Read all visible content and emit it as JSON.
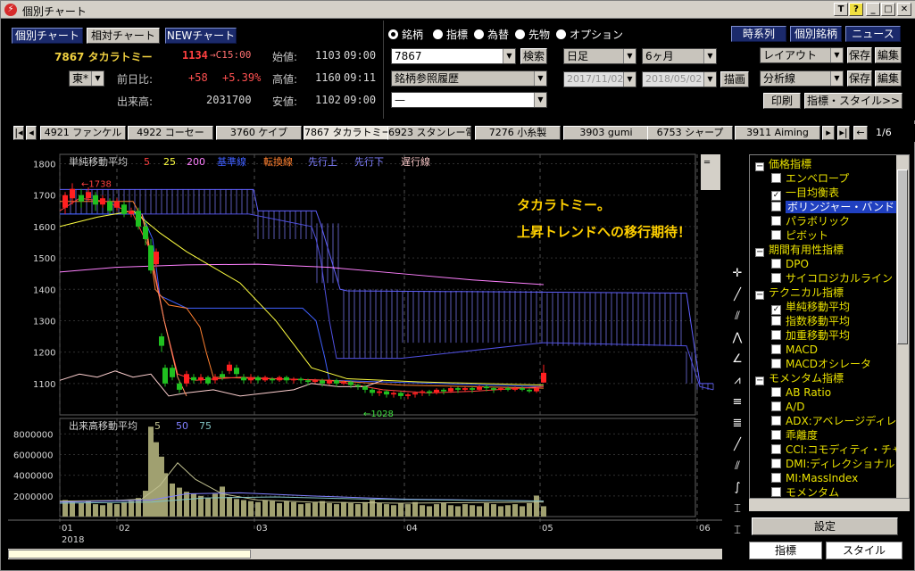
{
  "window": {
    "title": "個別チャート",
    "app_icon": "app-icon"
  },
  "title_buttons": [
    "T",
    "?",
    "_",
    "□",
    "✕"
  ],
  "top_nav": {
    "btn_individual": "個別チャート",
    "btn_relative": "相対チャート",
    "btn_new": "NEWチャート"
  },
  "top_right": {
    "btn_timeseries": "時系列",
    "btn_individual_stocks": "個別銘柄",
    "btn_news": "ニュース"
  },
  "stock": {
    "code_name": "7867 タカラトミー",
    "price": "1134",
    "arrow_close": "→C15:00",
    "exchange": "東*",
    "change_label": "前日比:",
    "change_value": "+58",
    "change_pct": "+5.39%",
    "volume_label": "出来高:",
    "volume_value": "2031700",
    "open_label": "始値:",
    "open_value": "1103",
    "open_time": "09:00",
    "high_label": "高値:",
    "high_value": "1160",
    "high_time": "09:11",
    "low_label": "安値:",
    "low_value": "1102",
    "low_time": "09:00"
  },
  "search": {
    "radio": [
      "銘柄",
      "指標",
      "為替",
      "先物",
      "オプション"
    ],
    "code_value": "7867",
    "search_btn": "検索",
    "history_value": "銘柄参照履歴",
    "blank_value": "—"
  },
  "period": {
    "type": "日足",
    "range": "6ヶ月",
    "from": "2017/11/02",
    "to": "2018/05/02",
    "draw_btn": "描画"
  },
  "layout": {
    "layout_label": "レイアウト",
    "save1": "保存",
    "edit1": "編集",
    "analysis_label": "分析線",
    "save2": "保存",
    "edit2": "編集",
    "print_btn": "印刷",
    "indicator_style_btn": "指標・スタイル>>"
  },
  "stock_tabs": [
    "4921 ファンケル",
    "4922 コーセー",
    "3760 ケイブ",
    "7867 タカラトミー",
    "6923 スタンレー電",
    "7276 小糸製",
    "3903 gumi",
    "6753 シャープ",
    "3911 Aiming"
  ],
  "stock_tabs_selected": 3,
  "page_indicator": "1/6",
  "chart_labels": {
    "sma_title": "単純移動平均",
    "sma_periods": [
      "5",
      "25",
      "200"
    ],
    "ichimoku": [
      "基準線",
      "転換線",
      "先行上",
      "先行下",
      "遅行線"
    ],
    "annotation_line1": "タカラトミー。",
    "annotation_line2": "上昇トレンドへの移行期待！",
    "high_marker": "←1738",
    "low_marker": "←1028",
    "volume_title": "出来高移動平均",
    "volume_periods": [
      "5",
      "50",
      "75"
    ],
    "year_label": "2018"
  },
  "chart_data": {
    "type": "line",
    "price_ylim": [
      1000,
      1830
    ],
    "price_ticks": [
      "1800",
      "1700",
      "1600",
      "1500",
      "1400",
      "1300",
      "1200",
      "1100"
    ],
    "volume_ticks": [
      "8000000",
      "6000000",
      "4000000",
      "2000000"
    ],
    "x_ticks": [
      "01",
      "02",
      "03",
      "04",
      "05",
      "06"
    ],
    "volume_ylim": [
      0,
      9500000
    ],
    "high_value": 1738,
    "low_value": 1028,
    "colors": {
      "up": "#ff2020",
      "down": "#20c020",
      "sma5": "#ff4040",
      "sma25": "#ffff40",
      "sma200": "#ff80ff",
      "kijun": "#4060ff",
      "tenkan": "#ff8030",
      "senkou_a": "#6060ff",
      "senkou_b": "#6060ff",
      "chikou": "#ffd0d0",
      "volume": "#a0a070",
      "cloud": "#8080ff"
    }
  },
  "sidebar": {
    "items": [
      {
        "level": 0,
        "label": "価格指標",
        "type": "group"
      },
      {
        "level": 1,
        "label": "エンベロープ",
        "checked": false
      },
      {
        "level": 1,
        "label": "一目均衡表",
        "checked": true
      },
      {
        "level": 1,
        "label": "ボリンジャー・バンド",
        "checked": false,
        "highlight": true
      },
      {
        "level": 1,
        "label": "パラボリック",
        "checked": false
      },
      {
        "level": 1,
        "label": "ピボット",
        "checked": false
      },
      {
        "level": 0,
        "label": "期間有用性指標",
        "type": "group"
      },
      {
        "level": 1,
        "label": "DPO",
        "checked": false
      },
      {
        "level": 1,
        "label": "サイコロジカルライン",
        "checked": false
      },
      {
        "level": 0,
        "label": "テクニカル指標",
        "type": "group"
      },
      {
        "level": 1,
        "label": "単純移動平均",
        "checked": true
      },
      {
        "level": 1,
        "label": "指数移動平均",
        "checked": false
      },
      {
        "level": 1,
        "label": "加重移動平均",
        "checked": false
      },
      {
        "level": 1,
        "label": "MACD",
        "checked": false
      },
      {
        "level": 1,
        "label": "MACDオシレータ",
        "checked": false
      },
      {
        "level": 0,
        "label": "モメンタム指標",
        "type": "group"
      },
      {
        "level": 1,
        "label": "AB Ratio",
        "checked": false
      },
      {
        "level": 1,
        "label": "A/D",
        "checked": false
      },
      {
        "level": 1,
        "label": "ADX:アベレージディレ",
        "checked": false
      },
      {
        "level": 1,
        "label": "乖離度",
        "checked": false
      },
      {
        "level": 1,
        "label": "CCI:コモディティ・チャ",
        "checked": false
      },
      {
        "level": 1,
        "label": "DMI:ディレクショナル",
        "checked": false
      },
      {
        "level": 1,
        "label": "MI:MassIndex",
        "checked": false
      },
      {
        "level": 1,
        "label": "モメンタム",
        "checked": false
      }
    ],
    "settings_btn": "設定",
    "tab_indicator": "指標",
    "tab_style": "スタイル"
  }
}
